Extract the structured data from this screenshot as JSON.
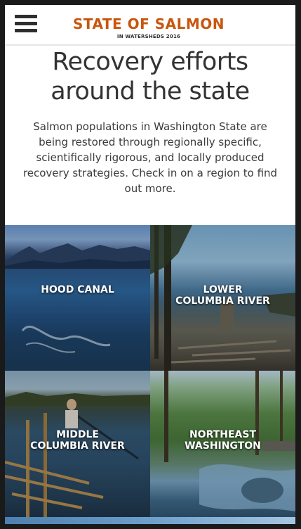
{
  "header": {
    "title": "STATE OF SALMON",
    "subtitle": "IN WATERSHEDS 2016"
  },
  "hero": {
    "title": "Recovery efforts around the state",
    "intro": "Salmon populations in Washington State are being restored through regionally specific, scientifically rigorous, and locally produced recovery strategies. Check in on a region to find out more."
  },
  "regions": [
    {
      "label": "HOOD CANAL"
    },
    {
      "label": "LOWER\nCOLUMBIA RIVER"
    },
    {
      "label": "MIDDLE\nCOLUMBIA RIVER"
    },
    {
      "label": "NORTHEAST\nWASHINGTON"
    }
  ],
  "colors": {
    "brand": "#c8560f",
    "text": "#333333"
  },
  "icons": {
    "menu": "hamburger-menu-icon"
  }
}
